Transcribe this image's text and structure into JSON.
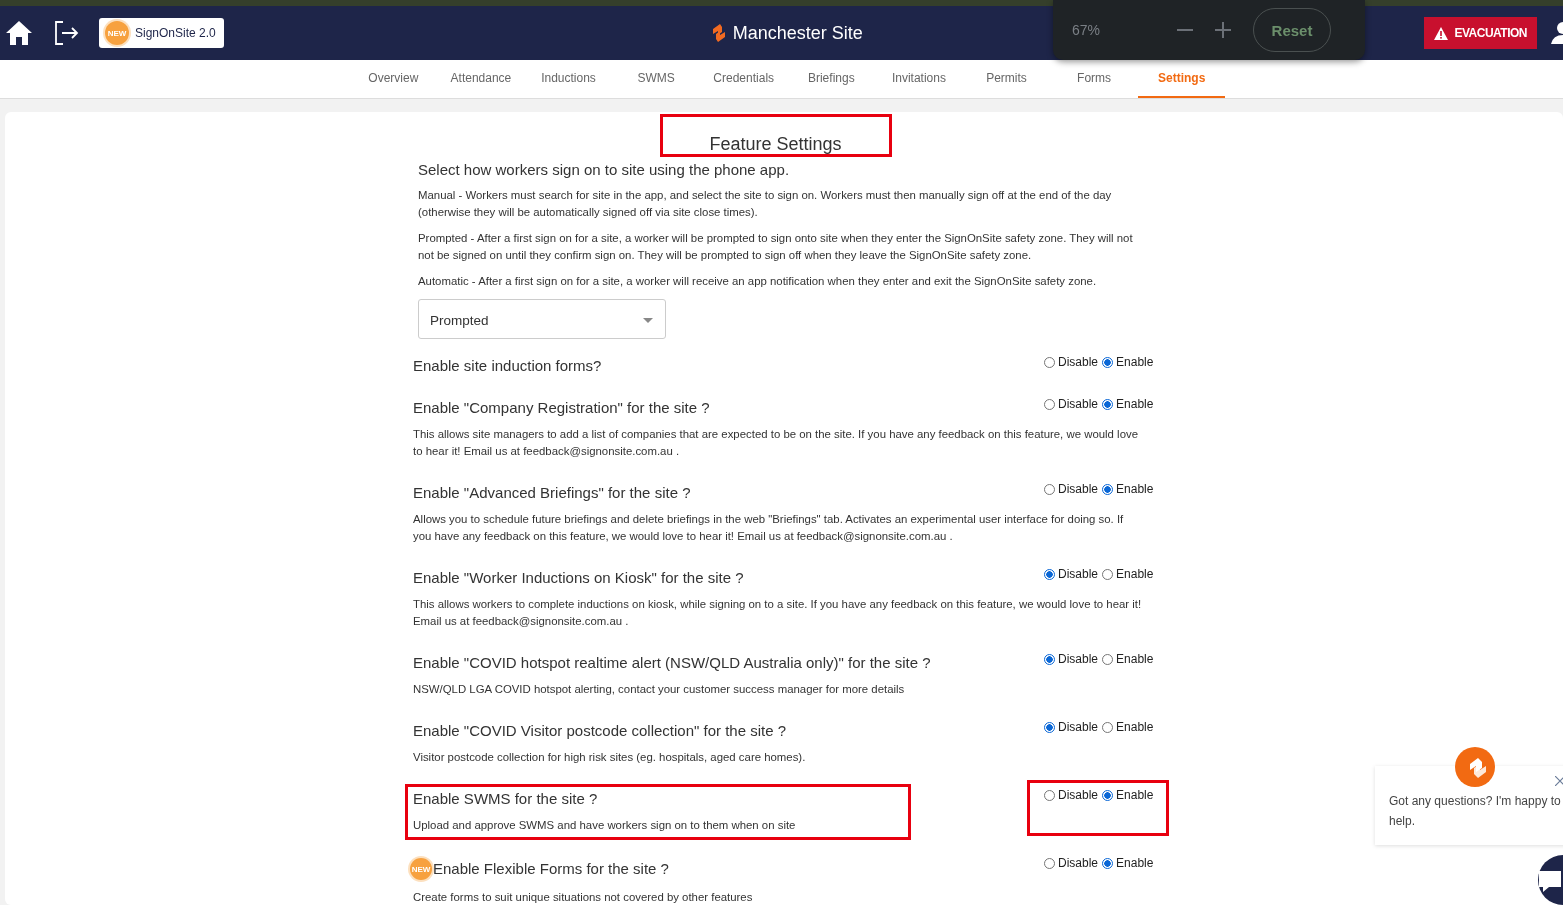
{
  "header": {
    "badge": {
      "tag": "NEW",
      "label": "SignOnSite 2.0"
    },
    "site_title": "Manchester Site",
    "zoom": {
      "value": "67%",
      "reset": "Reset"
    },
    "evacuation": "EVACUATION"
  },
  "tabs": [
    {
      "label": "Overview",
      "selected": false
    },
    {
      "label": "Attendance",
      "selected": false
    },
    {
      "label": "Inductions",
      "selected": false
    },
    {
      "label": "SWMS",
      "selected": false
    },
    {
      "label": "Credentials",
      "selected": false
    },
    {
      "label": "Briefings",
      "selected": false
    },
    {
      "label": "Invitations",
      "selected": false
    },
    {
      "label": "Permits",
      "selected": false
    },
    {
      "label": "Forms",
      "selected": false
    },
    {
      "label": "Settings",
      "selected": true
    }
  ],
  "settings": {
    "title": "Feature Settings",
    "title_highlighted": true,
    "sign_on": {
      "heading": "Select how workers sign on to site using the phone app.",
      "paragraphs": [
        "Manual - Workers must search for site in the app, and select the site to sign on. Workers must then manually sign off at the end of the day (otherwise they will be automatically signed off via site close times).",
        "Prompted - After a first sign on for a site, a worker will be prompted to sign onto site when they enter the SignOnSite safety zone. They will not not be signed on until they confirm sign on. They will be prompted to sign off when they leave the SignOnSite safety zone.",
        "Automatic - After a first sign on for a site, a worker will receive an app notification when they enter and exit the SignOnSite safety zone."
      ],
      "mode": "Prompted"
    },
    "features": [
      {
        "title": "Enable site induction forms?",
        "highlighted": false,
        "options": [
          {
            "label": "Disable",
            "selected": false
          },
          {
            "label": "Enable",
            "selected": true
          }
        ]
      },
      {
        "title": "Enable \"Company Registration\" for the site ?",
        "description": "This allows site managers to add a list of companies that are expected to be on the site. If you have any feedback on this feature, we would love to hear it! Email us at feedback@signonsite.com.au .",
        "highlighted": false,
        "options": [
          {
            "label": "Disable",
            "selected": false
          },
          {
            "label": "Enable",
            "selected": true
          }
        ]
      },
      {
        "title": "Enable \"Advanced Briefings\" for the site ?",
        "description": "Allows you to schedule future briefings and delete briefings in the web \"Briefings\" tab. Activates an experimental user interface for doing so. If you have any feedback on this feature, we would love to hear it! Email us at feedback@signonsite.com.au .",
        "highlighted": false,
        "options": [
          {
            "label": "Disable",
            "selected": false
          },
          {
            "label": "Enable",
            "selected": true
          }
        ]
      },
      {
        "title": "Enable \"Worker Inductions on Kiosk\" for the site ?",
        "description": "This allows workers to complete inductions on kiosk, while signing on to a site. If you have any feedback on this feature, we would love to hear it! Email us at feedback@signonsite.com.au .",
        "highlighted": false,
        "options": [
          {
            "label": "Disable",
            "selected": true
          },
          {
            "label": "Enable",
            "selected": false
          }
        ]
      },
      {
        "title": "Enable \"COVID hotspot realtime alert (NSW/QLD Australia only)\" for the site ?",
        "description": "NSW/QLD LGA COVID hotspot alerting, contact your customer success manager for more details",
        "highlighted": false,
        "options": [
          {
            "label": "Disable",
            "selected": true
          },
          {
            "label": "Enable",
            "selected": false
          }
        ]
      },
      {
        "title": "Enable \"COVID Visitor postcode collection\" for the site ?",
        "description": "Visitor postcode collection for high risk sites (eg. hospitals, aged care homes).",
        "highlighted": false,
        "options": [
          {
            "label": "Disable",
            "selected": true
          },
          {
            "label": "Enable",
            "selected": false
          }
        ]
      },
      {
        "title": "Enable SWMS for the site ?",
        "description": "Upload and approve SWMS and have workers sign on to them when on site",
        "highlighted": true,
        "options": [
          {
            "label": "Disable",
            "selected": false
          },
          {
            "label": "Enable",
            "selected": true
          }
        ]
      },
      {
        "title": "Enable Flexible Forms for the site ?",
        "badge": "NEW",
        "description": "Create forms to suit unique situations not covered by other features",
        "highlighted": false,
        "options": [
          {
            "label": "Disable",
            "selected": false
          },
          {
            "label": "Enable",
            "selected": true
          }
        ]
      }
    ]
  },
  "chat": {
    "message": "Got any questions? I'm happy to help."
  }
}
